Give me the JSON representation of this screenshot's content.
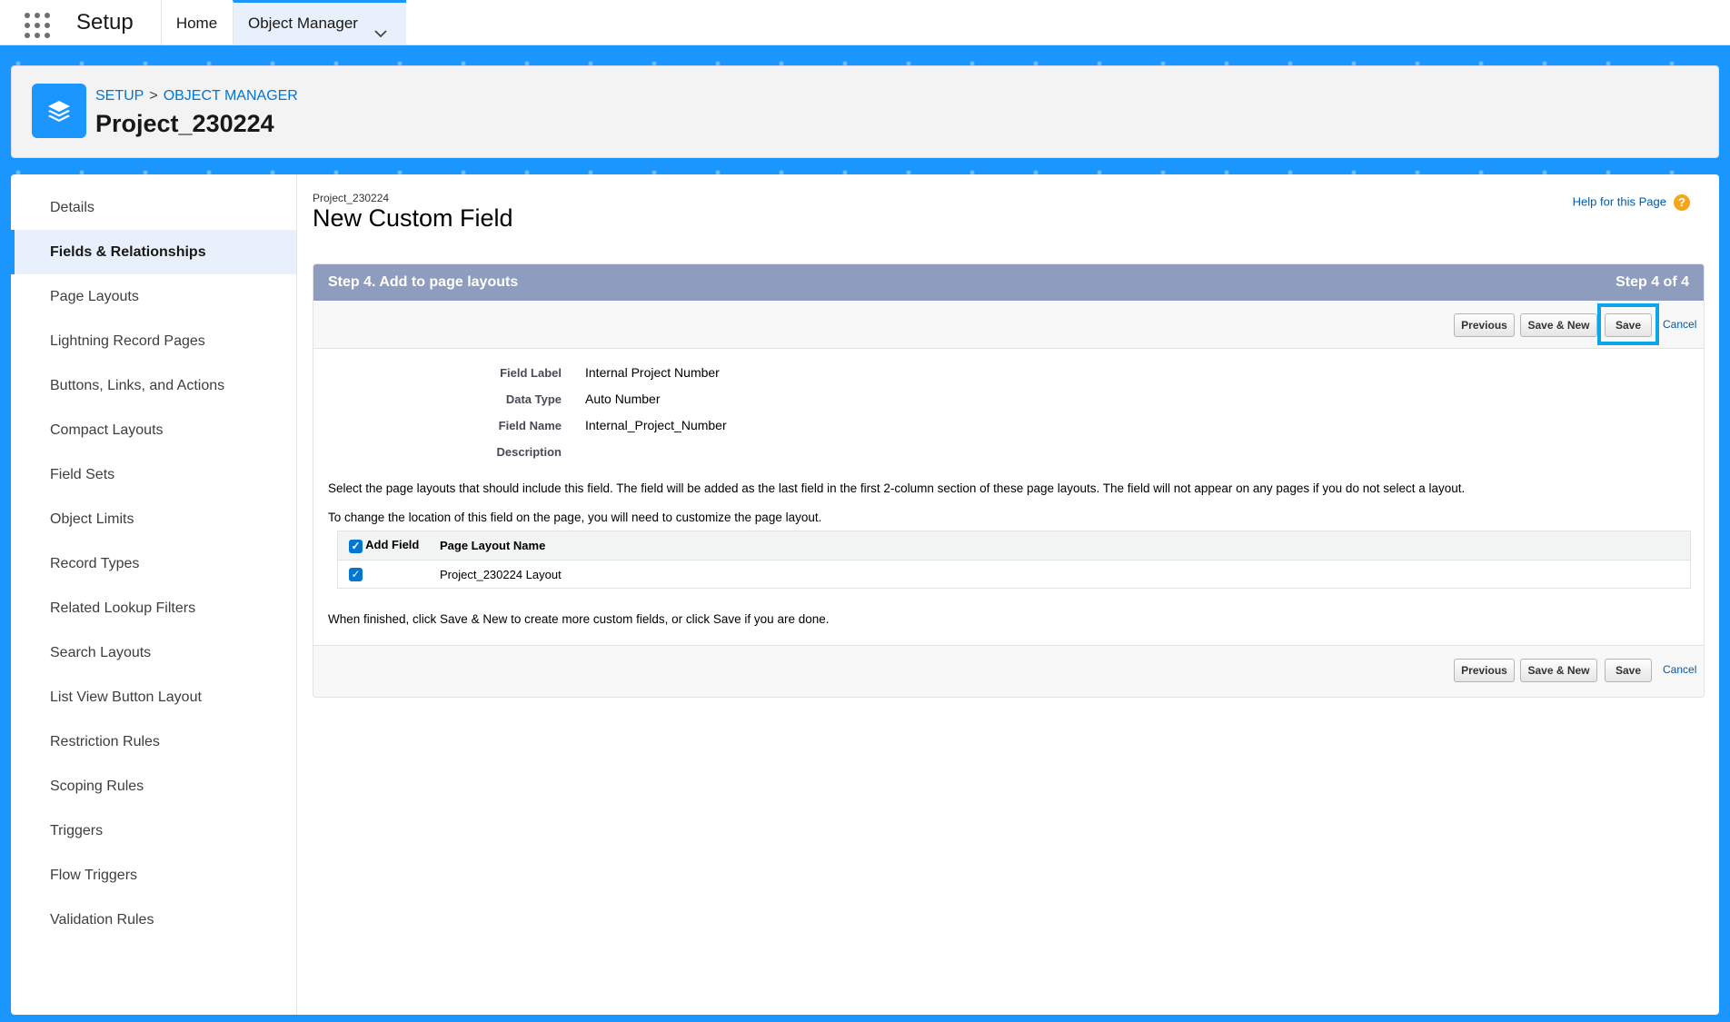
{
  "topnav": {
    "app_name": "Setup",
    "tabs": [
      "Home",
      "Object Manager"
    ]
  },
  "header": {
    "breadcrumb": [
      "SETUP",
      "OBJECT MANAGER"
    ],
    "breadcrumb_separator": ">",
    "object_title": "Project_230224"
  },
  "sidebar": {
    "items": [
      "Details",
      "Fields & Relationships",
      "Page Layouts",
      "Lightning Record Pages",
      "Buttons, Links, and Actions",
      "Compact Layouts",
      "Field Sets",
      "Object Limits",
      "Record Types",
      "Related Lookup Filters",
      "Search Layouts",
      "List View Button Layout",
      "Restriction Rules",
      "Scoping Rules",
      "Triggers",
      "Flow Triggers",
      "Validation Rules"
    ],
    "active_index": 1
  },
  "page": {
    "object_name": "Project_230224",
    "title": "New Custom Field",
    "help_link": "Help for this Page",
    "help_icon": "?"
  },
  "step": {
    "title": "Step 4. Add to page layouts",
    "counter": "Step 4 of 4"
  },
  "buttons": {
    "previous": "Previous",
    "save_new": "Save & New",
    "save": "Save",
    "cancel": "Cancel"
  },
  "field_details": {
    "rows": [
      {
        "label": "Field Label",
        "value": "Internal Project Number"
      },
      {
        "label": "Data Type",
        "value": "Auto Number"
      },
      {
        "label": "Field Name",
        "value": "Internal_Project_Number"
      },
      {
        "label": "Description",
        "value": ""
      }
    ]
  },
  "instructions": {
    "line1": "Select the page layouts that should include this field. The field will be added as the last field in the first 2-column section of these page layouts. The field will not appear on any pages if you do not select a layout.",
    "line2": "To change the location of this field on the page, you will need to customize the page layout.",
    "finish": "When finished, click Save & New to create more custom fields, or click Save if you are done."
  },
  "layout_table": {
    "headers": [
      "Add Field",
      "Page Layout Name"
    ],
    "rows": [
      {
        "checked": true,
        "name": "Project_230224 Layout"
      }
    ],
    "header_checked": true
  },
  "colors": {
    "brand_blue": "#1b96ff",
    "step_header": "#8e9dbd",
    "highlight": "#0aa6e8",
    "link": "#015ba7"
  }
}
